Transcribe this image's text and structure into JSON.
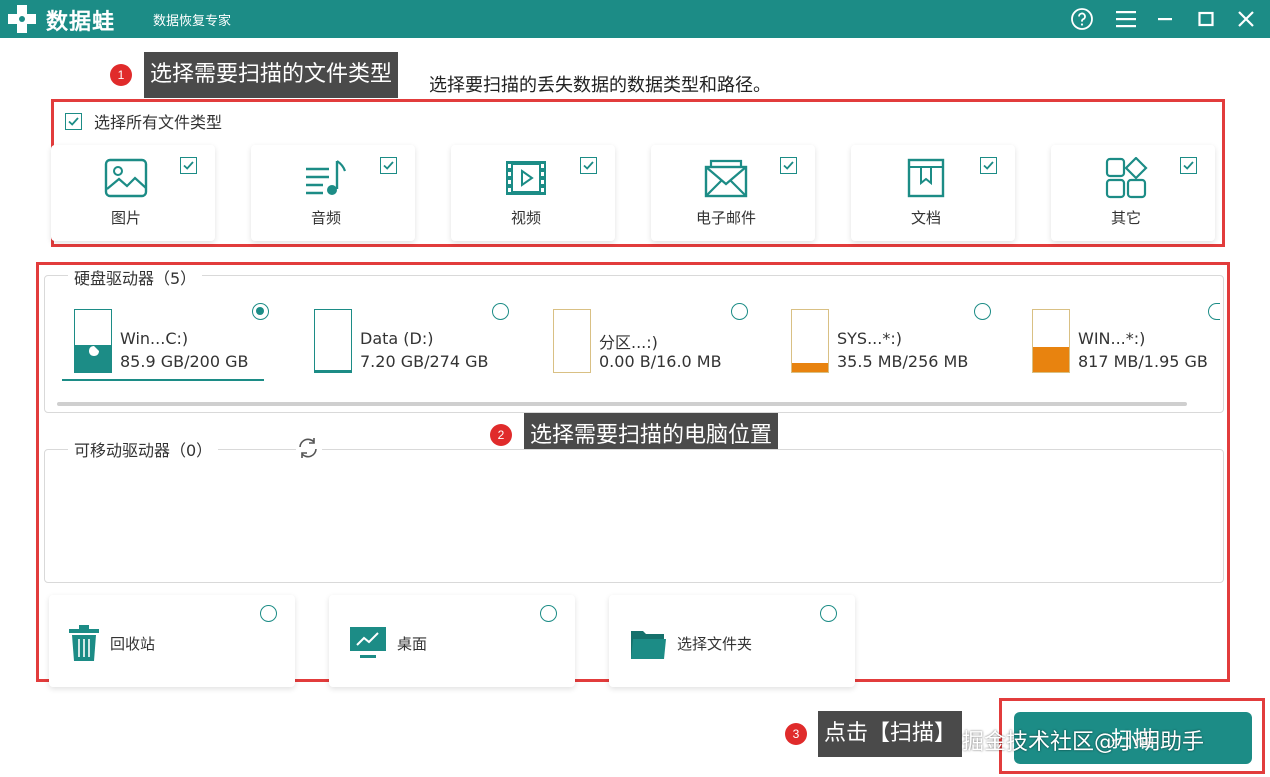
{
  "app": {
    "name": "数据蛙",
    "subtitle": "数据恢复专家"
  },
  "titlebar_buttons": [
    "help-icon",
    "menu-icon",
    "minimize-icon",
    "maximize-icon",
    "close-icon"
  ],
  "instruction": "选择要扫描的丢失数据的数据类型和路径。",
  "annotations": [
    {
      "number": "1",
      "text": "选择需要扫描的文件类型"
    },
    {
      "number": "2",
      "text": "选择需要扫描的电脑位置"
    },
    {
      "number": "3",
      "text": "点击【扫描】"
    }
  ],
  "select_all": {
    "label": "选择所有文件类型",
    "checked": true
  },
  "file_types": [
    {
      "label": "图片",
      "icon": "image-icon",
      "checked": true
    },
    {
      "label": "音频",
      "icon": "audio-icon",
      "checked": true
    },
    {
      "label": "视频",
      "icon": "video-icon",
      "checked": true
    },
    {
      "label": "电子邮件",
      "icon": "email-icon",
      "checked": true
    },
    {
      "label": "文档",
      "icon": "document-icon",
      "checked": true
    },
    {
      "label": "其它",
      "icon": "other-icon",
      "checked": true
    }
  ],
  "hard_drives": {
    "title": "硬盘驱动器（5）",
    "drives": [
      {
        "name": "Win...C:)",
        "size": "85.9 GB/200 GB",
        "used_fraction": 0.43,
        "selected": true,
        "fill_color": "#1c8c86"
      },
      {
        "name": "Data (D:)",
        "size": "7.20 GB/274 GB",
        "used_fraction": 0.03,
        "selected": false,
        "fill_color": "#1c8c86"
      },
      {
        "name": "分区...:)",
        "size": "0.00  B/16.0 MB",
        "used_fraction": 0.0,
        "selected": false,
        "fill_color": "#e8830f"
      },
      {
        "name": "SYS...*:)",
        "size": "35.5 MB/256 MB",
        "used_fraction": 0.14,
        "selected": false,
        "fill_color": "#e8830f"
      },
      {
        "name": "WIN...*:)",
        "size": "817 MB/1.95 GB",
        "used_fraction": 0.41,
        "selected": false,
        "fill_color": "#e8830f"
      }
    ]
  },
  "removable": {
    "title": "可移动驱动器（0）"
  },
  "locations": [
    {
      "label": "回收站",
      "icon": "recycle-bin-icon",
      "selected": false
    },
    {
      "label": "桌面",
      "icon": "desktop-icon",
      "selected": false
    },
    {
      "label": "选择文件夹",
      "icon": "folder-icon",
      "selected": false
    }
  ],
  "scan_button": "扫描",
  "watermark": "掘金技术社区@小明助手",
  "colors": {
    "accent": "#1c8c86",
    "annotation_red": "#e23c3c",
    "drive_warn": "#e8830f"
  }
}
